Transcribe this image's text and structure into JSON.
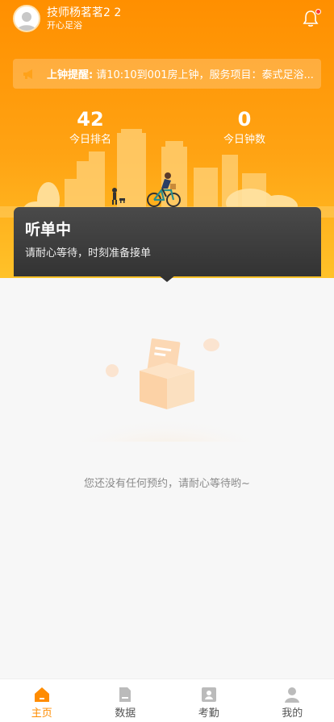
{
  "user": {
    "name": "技师杨茗茗2 2",
    "shop": "开心足浴"
  },
  "icons": {
    "avatar": "avatar-icon",
    "bell": "bell-icon",
    "notice": "megaphone-icon"
  },
  "notice": {
    "label": "上钟提醒:",
    "text": "请10:10到001房上钟，服务项目：泰式足浴..."
  },
  "stats": [
    {
      "value": "42",
      "label": "今日排名"
    },
    {
      "value": "0",
      "label": "今日钟数"
    }
  ],
  "status": {
    "title": "听单中",
    "subtitle": "请耐心等待，时刻准备接单"
  },
  "empty": {
    "text": "您还没有任何预约，请耐心等待哟~"
  },
  "tabs": [
    {
      "label": "主页",
      "icon": "home-icon",
      "active": true
    },
    {
      "label": "数据",
      "icon": "data-icon",
      "active": false
    },
    {
      "label": "考勤",
      "icon": "attendance-icon",
      "active": false
    },
    {
      "label": "我的",
      "icon": "profile-icon",
      "active": false
    }
  ],
  "colors": {
    "accent": "#ff8c00",
    "inactive": "#bbbbbb",
    "card": "#3d3d3d"
  }
}
